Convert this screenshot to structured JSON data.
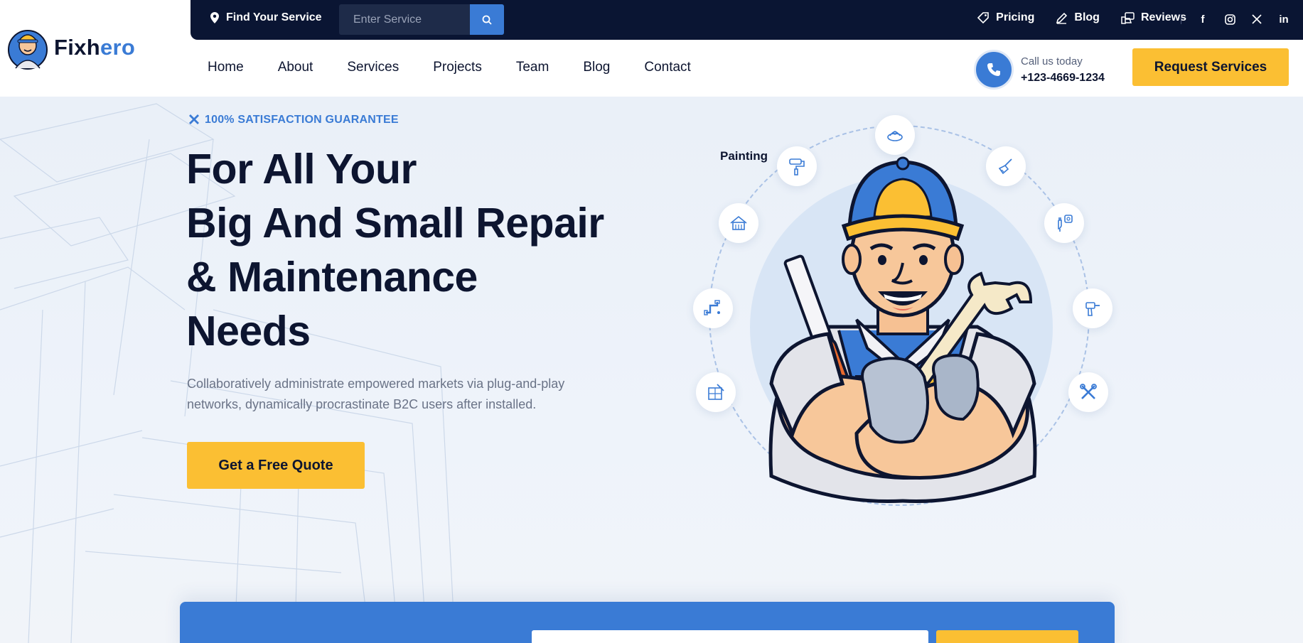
{
  "brand": {
    "name_main": "Fixh",
    "name_accent": "ero"
  },
  "topbar": {
    "find_service": "Find Your Service",
    "search_placeholder": "Enter Service",
    "links": [
      {
        "label": "Pricing",
        "icon": "tag-icon"
      },
      {
        "label": "Blog",
        "icon": "pen-icon"
      },
      {
        "label": "Reviews",
        "icon": "review-icon"
      }
    ],
    "socials": [
      {
        "name": "facebook-icon",
        "glyph": "f"
      },
      {
        "name": "instagram-icon",
        "glyph": "◎"
      },
      {
        "name": "x-icon",
        "glyph": "𝕏"
      },
      {
        "name": "linkedin-icon",
        "glyph": "in"
      }
    ]
  },
  "nav": {
    "items": [
      "Home",
      "About",
      "Services",
      "Projects",
      "Team",
      "Blog",
      "Contact"
    ]
  },
  "call": {
    "label": "Call us today",
    "number": "+123-4669-1234"
  },
  "request_button": "Request Services",
  "hero": {
    "guarantee": "100% SATISFACTION GUARANTEE",
    "headline": [
      "For All Your",
      "Big And Small Repair",
      "& Maintenance",
      "Needs"
    ],
    "description": "Collaboratively administrate empowered markets via plug-and-play networks, dynamically procrastinate B2C users after installed.",
    "cta": "Get a Free Quote",
    "orbit_label": "Painting",
    "orbit_icons": [
      "roller-brush-icon",
      "robot-vacuum-icon",
      "broom-icon",
      "house-icon",
      "plug-icon",
      "pipe-icon",
      "drill-icon",
      "window-clean-icon",
      "tools-icon"
    ]
  },
  "colors": {
    "navy": "#0a1533",
    "blue": "#3a7bd5",
    "yellow": "#fbbf33"
  }
}
